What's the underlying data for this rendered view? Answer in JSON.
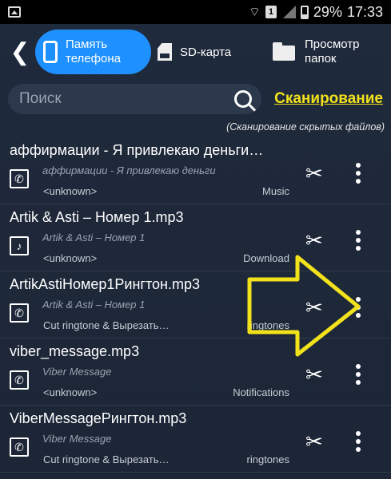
{
  "status_bar": {
    "wifi": "wifi-icon",
    "sim_badge": "1",
    "battery_percent": "29%",
    "time": "17:33"
  },
  "topbar": {
    "tabs": [
      {
        "label": "Память телефона",
        "active": true,
        "icon": "phone-icon"
      },
      {
        "label": "SD-карта",
        "active": false,
        "icon": "sd-card-icon"
      },
      {
        "label": "Просмотр папок",
        "active": false,
        "icon": "folder-icon"
      }
    ]
  },
  "search": {
    "placeholder": "Поиск",
    "scan_label": "Сканирование",
    "scan_note": "(Сканирование скрытых файлов)"
  },
  "list": [
    {
      "title": "аффирмации - Я привлекаю деньги…",
      "subtitle": "аффирмации - Я привлекаю деньги",
      "left_meta": "<unknown>",
      "right_meta": "Music",
      "type_icon": "phone-icon"
    },
    {
      "title": "Artik & Asti – Номер 1.mp3",
      "subtitle": "Artik & Asti – Номер 1",
      "left_meta": "<unknown>",
      "right_meta": "Download",
      "type_icon": "music-note-icon"
    },
    {
      "title": "ArtikAstiНомер1Рингтон.mp3",
      "subtitle": "Artik & Asti – Номер 1",
      "left_meta": "Cut ringtone & Вырезать…",
      "right_meta": "ringtones",
      "type_icon": "phone-icon"
    },
    {
      "title": "viber_message.mp3",
      "subtitle": "Viber Message",
      "left_meta": "<unknown>",
      "right_meta": "Notifications",
      "type_icon": "phone-icon"
    },
    {
      "title": "ViberMessageРингтон.mp3",
      "subtitle": "Viber Message",
      "left_meta": "Cut ringtone & Вырезать…",
      "right_meta": "ringtones",
      "type_icon": "phone-icon"
    }
  ],
  "colors": {
    "accent": "#1e90ff",
    "link": "#f2e21c",
    "background": "#1f2a3c",
    "arrow": "#f2e21c"
  }
}
